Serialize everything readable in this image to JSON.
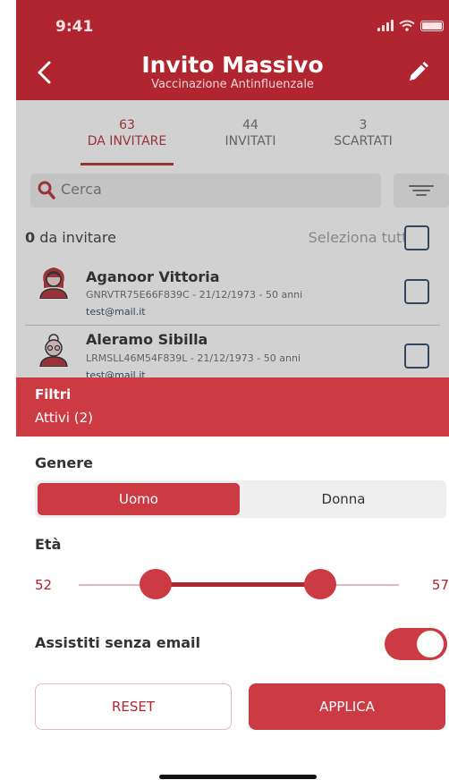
{
  "status_bar": {
    "time": "9:41"
  },
  "header": {
    "title": "Invito Massivo",
    "subtitle": "Vaccinazione Antinfluenzale",
    "back_icon": "chevron-left-icon",
    "edit_icon": "pencil-icon"
  },
  "tabs": [
    {
      "count": "63",
      "label": "DA INVITARE",
      "active": true
    },
    {
      "count": "44",
      "label": "INVITATI",
      "active": false
    },
    {
      "count": "3",
      "label": "SCARTATI",
      "active": false
    }
  ],
  "search": {
    "placeholder": "Cerca"
  },
  "summary": {
    "count": "0",
    "text": "da invitare",
    "select_all": "Seleziona tutti"
  },
  "list": [
    {
      "name": "Aganoor Vittoria",
      "detail": "GNRVTR75E66F839C - 21/12/1973 - 50 anni",
      "email": "test@mail.it"
    },
    {
      "name": "Aleramo Sibilla",
      "detail": "LRMSLL46M54F839L - 21/12/1973 - 50 anni",
      "email": "test@mail.it"
    }
  ],
  "filters": {
    "title": "Filtri",
    "active_label": "Attivi (2)",
    "gender": {
      "label": "Genere",
      "options": [
        "Uomo",
        "Donna"
      ],
      "selected": "Uomo"
    },
    "age": {
      "label": "Età",
      "min": "52",
      "max": "57"
    },
    "no_email": {
      "label": "Assistiti senza email",
      "enabled": true
    },
    "reset_label": "RESET",
    "apply_label": "APPLICA"
  },
  "colors": {
    "brand_red": "#b0252f",
    "accent_red": "#cc3a44",
    "checkbox_navy": "#24405e"
  }
}
